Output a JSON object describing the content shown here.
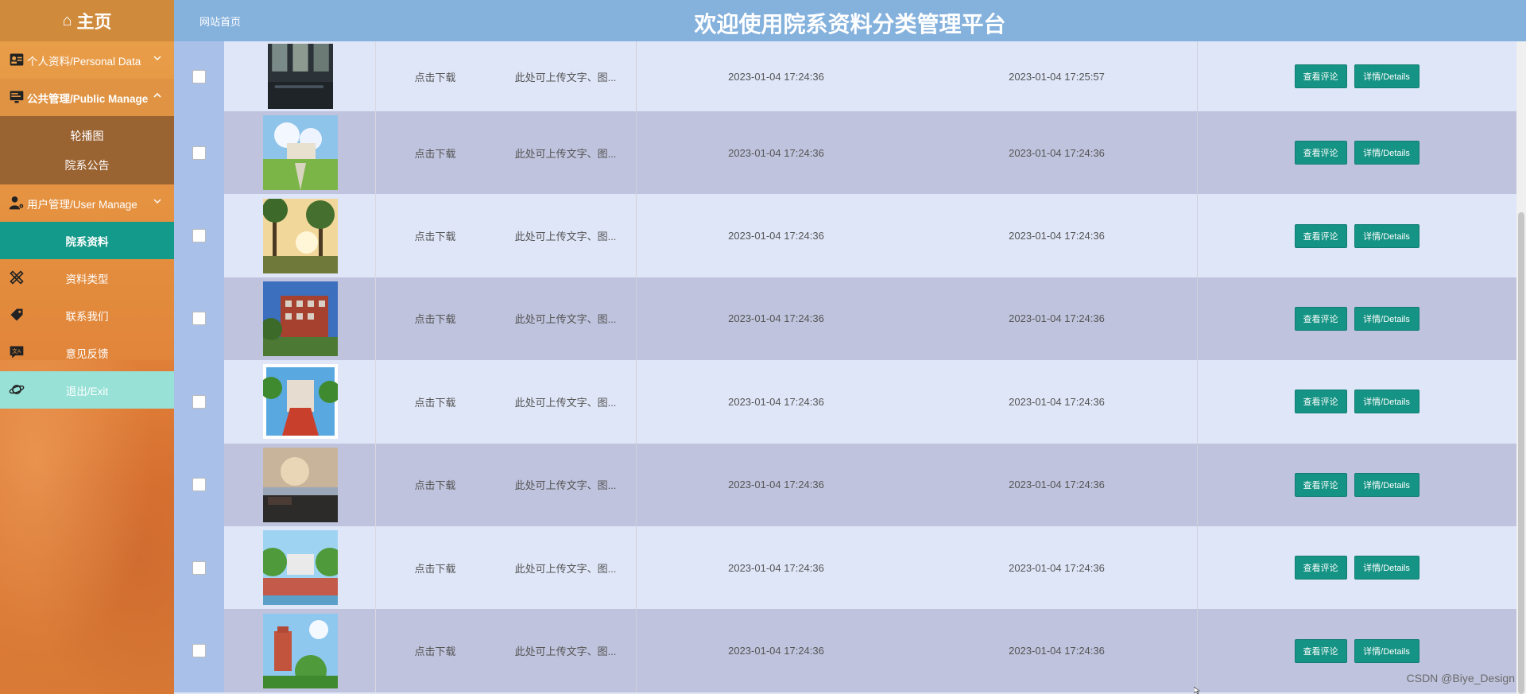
{
  "sidebar": {
    "home": "主页",
    "items": [
      {
        "label": "个人资料/Personal Data",
        "icon": "id-card-icon"
      },
      {
        "label": "公共管理/Public Manage",
        "icon": "monitor-icon"
      },
      {
        "label": "用户管理/User Manage",
        "icon": "user-gear-icon"
      },
      {
        "label": "院系资料"
      },
      {
        "label": "资料类型",
        "icon": "ruler-pencil-icon"
      },
      {
        "label": "联系我们",
        "icon": "tag-icon"
      },
      {
        "label": "意见反馈",
        "icon": "chat-icon"
      },
      {
        "label": "退出/Exit",
        "icon": "planet-icon"
      }
    ],
    "submenu": [
      "轮播图",
      "院系公告"
    ]
  },
  "header": {
    "nav_home": "网站首页",
    "title": "欢迎使用院系资料分类管理平台"
  },
  "table": {
    "rows": [
      {
        "download": "点击下载",
        "desc": "此处可上传文字、图...",
        "created": "2023-01-04 17:24:36",
        "updated": "2023-01-04 17:25:57"
      },
      {
        "download": "点击下载",
        "desc": "此处可上传文字、图...",
        "created": "2023-01-04 17:24:36",
        "updated": "2023-01-04 17:24:36"
      },
      {
        "download": "点击下载",
        "desc": "此处可上传文字、图...",
        "created": "2023-01-04 17:24:36",
        "updated": "2023-01-04 17:24:36"
      },
      {
        "download": "点击下载",
        "desc": "此处可上传文字、图...",
        "created": "2023-01-04 17:24:36",
        "updated": "2023-01-04 17:24:36"
      },
      {
        "download": "点击下载",
        "desc": "此处可上传文字、图...",
        "created": "2023-01-04 17:24:36",
        "updated": "2023-01-04 17:24:36"
      },
      {
        "download": "点击下载",
        "desc": "此处可上传文字、图...",
        "created": "2023-01-04 17:24:36",
        "updated": "2023-01-04 17:24:36"
      },
      {
        "download": "点击下载",
        "desc": "此处可上传文字、图...",
        "created": "2023-01-04 17:24:36",
        "updated": "2023-01-04 17:24:36"
      },
      {
        "download": "点击下载",
        "desc": "此处可上传文字、图...",
        "created": "2023-01-04 17:24:36",
        "updated": "2023-01-04 17:24:36"
      }
    ],
    "view_label": "查看评论",
    "detail_label": "详情/Details"
  },
  "watermark": "CSDN @Biye_Design",
  "colors": {
    "accent": "#159384",
    "header": "#85b1dd",
    "sidebar": "#e48f3f"
  }
}
